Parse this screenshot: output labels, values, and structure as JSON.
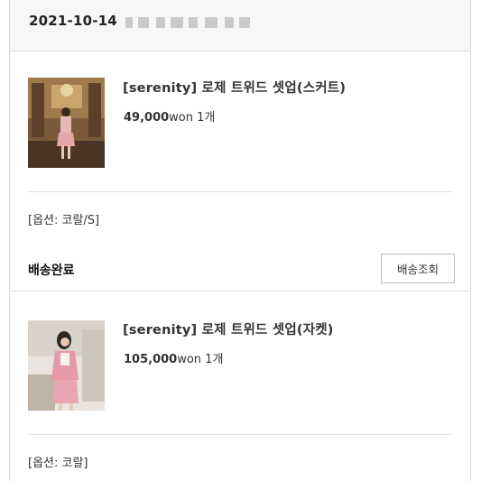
{
  "order": {
    "date": "2021-10-14"
  },
  "items": [
    {
      "title": "[serenity] 로제 트위드 셋업(스커트)",
      "price": "49,000",
      "currency_qty": "won 1개",
      "option": "[옵션: 코랄/S]"
    },
    {
      "title": "[serenity] 로제 트위드 셋업(자켓)",
      "price": "105,000",
      "currency_qty": "won 1개",
      "option": "[옵션: 코랄]"
    }
  ],
  "delivery": {
    "status": "배송완료",
    "track_button": "배송조회"
  },
  "colors": {
    "header_bg": "#f7f7f7",
    "border": "#dcdcdc",
    "text": "#222222"
  }
}
